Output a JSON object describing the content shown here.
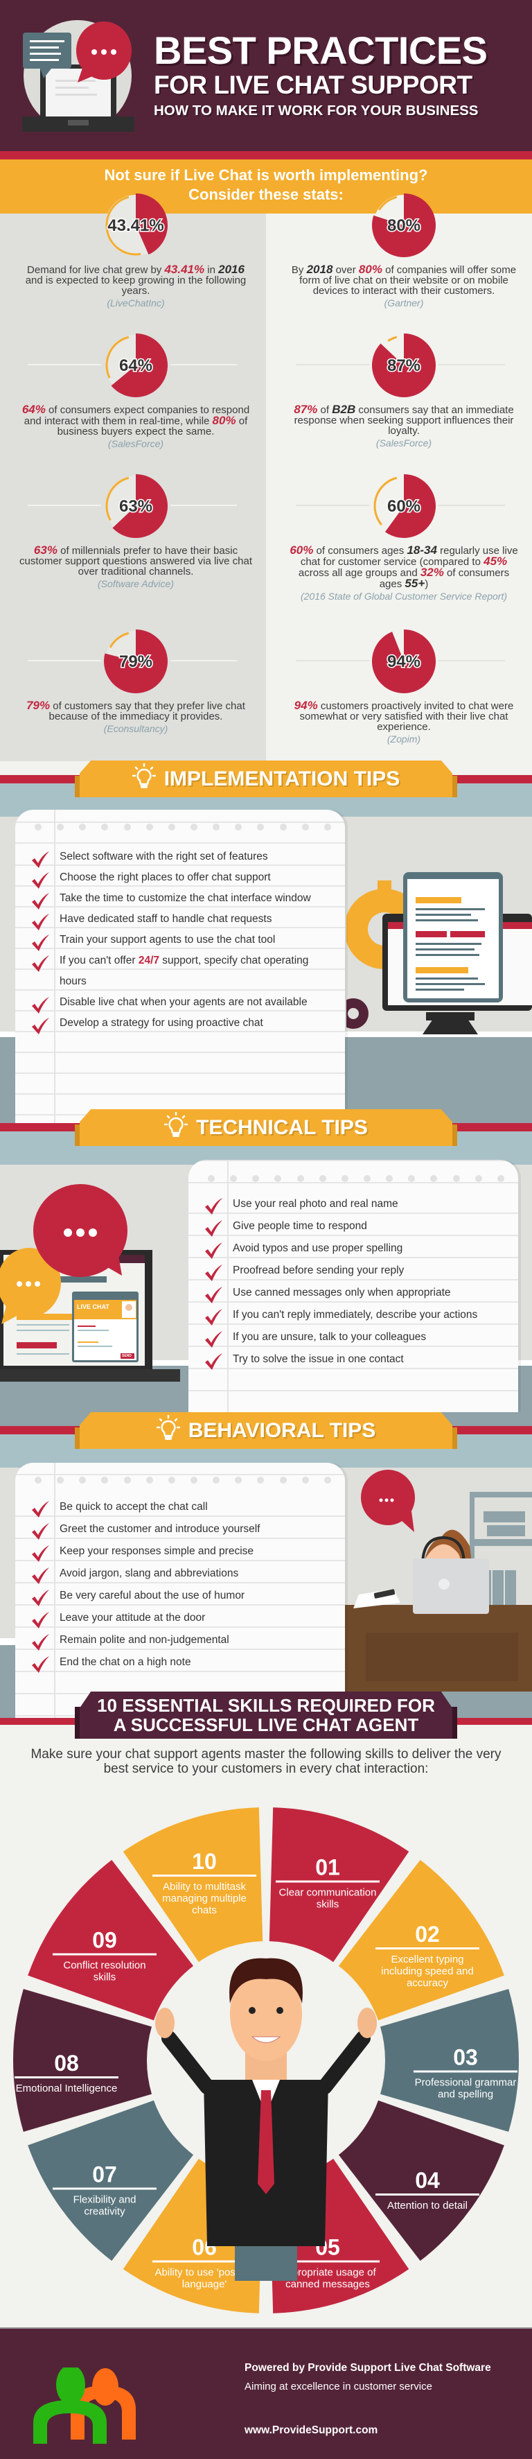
{
  "header": {
    "title_line1": "BEST PRACTICES",
    "title_line2": "FOR LIVE CHAT SUPPORT",
    "subtitle": "HOW TO MAKE IT WORK FOR YOUR BUSINESS"
  },
  "stats_intro": {
    "line1": "Not sure if Live Chat is worth implementing?",
    "line2": "Consider these stats:"
  },
  "colors": {
    "red": "#c2263f",
    "orange": "#f4ad2e",
    "slate": "#58737b",
    "maroon": "#532438",
    "source": "#8aa2ac"
  },
  "stats": {
    "left": [
      {
        "value": 43.41,
        "label": "43.41%",
        "segments": [
          {
            "text": "Demand for live chat grew by "
          },
          {
            "text": "43.41%",
            "style": "red"
          },
          {
            "text": " in "
          },
          {
            "text": "2016",
            "style": "dark"
          },
          {
            "text": " and is expected to keep growing in the following years."
          }
        ],
        "source": "(LiveChatInc)"
      },
      {
        "value": 64,
        "label": "64%",
        "segments": [
          {
            "text": "64%",
            "style": "red"
          },
          {
            "text": " of consumers expect companies to respond and interact with them in real-time, while "
          },
          {
            "text": "80%",
            "style": "red"
          },
          {
            "text": " of business buyers expect the same."
          }
        ],
        "source": "(SalesForce)"
      },
      {
        "value": 63,
        "label": "63%",
        "segments": [
          {
            "text": "63%",
            "style": "red"
          },
          {
            "text": " of millennials prefer to have their basic customer support questions answered via live chat over traditional channels."
          }
        ],
        "source": "(Software Advice)"
      },
      {
        "value": 79,
        "label": "79%",
        "segments": [
          {
            "text": "79%",
            "style": "red"
          },
          {
            "text": " of customers say that they prefer live chat because of the immediacy it provides."
          }
        ],
        "source": "(Econsultancy)"
      }
    ],
    "right": [
      {
        "value": 80,
        "label": "80%",
        "segments": [
          {
            "text": "By "
          },
          {
            "text": "2018",
            "style": "dark"
          },
          {
            "text": " over "
          },
          {
            "text": "80%",
            "style": "red"
          },
          {
            "text": " of companies will offer some form of live chat on their website or on mobile devices to interact with their customers."
          }
        ],
        "source": "(Gartner)"
      },
      {
        "value": 87,
        "label": "87%",
        "segments": [
          {
            "text": "87%",
            "style": "red"
          },
          {
            "text": " of "
          },
          {
            "text": "B2B",
            "style": "dark"
          },
          {
            "text": " consumers say that an immediate response when seeking support influences their loyalty."
          }
        ],
        "source": "(SalesForce)"
      },
      {
        "value": 60,
        "label": "60%",
        "segments": [
          {
            "text": "60%",
            "style": "red"
          },
          {
            "text": " of consumers ages "
          },
          {
            "text": "18-34",
            "style": "dark"
          },
          {
            "text": " regularly use live chat for customer service (compared to "
          },
          {
            "text": "45%",
            "style": "red"
          },
          {
            "text": " across all age groups and "
          },
          {
            "text": "32%",
            "style": "red"
          },
          {
            "text": " of consumers ages "
          },
          {
            "text": "55+",
            "style": "dark"
          },
          {
            "text": ")"
          }
        ],
        "source": "(2016 State of Global Customer Service Report)"
      },
      {
        "value": 94,
        "label": "94%",
        "segments": [
          {
            "text": "94%",
            "style": "red"
          },
          {
            "text": " customers proactively invited to chat were somewhat or very satisfied with their live chat experience."
          }
        ],
        "source": "(Zopim)"
      }
    ]
  },
  "tips": {
    "implementation": {
      "title": "IMPLEMENTATION TIPS",
      "items": [
        "Select software with the right set of features",
        "Choose the right places to offer chat support",
        "Take the time to customize the chat interface window",
        "Have dedicated staff to handle chat requests",
        "Train your support agents to use the chat tool",
        [
          {
            "text": "If you can't offer "
          },
          {
            "text": "24/7",
            "style": "red"
          },
          {
            "text": " support, specify chat operating hours"
          }
        ],
        "Disable live chat when your agents are not available",
        "Develop a strategy for using proactive chat"
      ]
    },
    "technical": {
      "title": "TECHNICAL TIPS",
      "illustration_label": "LIVE CHAT",
      "send_label": "SEND",
      "items": [
        "Use your real photo and real name",
        "Give people time to respond",
        "Avoid typos and use proper spelling",
        "Proofread before sending your reply",
        "Use canned messages only when appropriate",
        "If you can't reply immediately, describe your actions",
        "If you are unsure, talk to your colleagues",
        "Try to solve the issue in one contact"
      ]
    },
    "behavioral": {
      "title": "BEHAVIORAL TIPS",
      "items": [
        "Be quick to accept the chat call",
        "Greet the customer and introduce yourself",
        "Keep your responses simple and precise",
        "Avoid jargon, slang and abbreviations",
        "Be very careful about the use of humor",
        "Leave your attitude at the door",
        "Remain polite and non-judgemental",
        "End the chat on a high note"
      ]
    }
  },
  "skills": {
    "title_line1": "10 ESSENTIAL SKILLS REQUIRED FOR",
    "title_line2": "A SUCCESSFUL LIVE CHAT AGENT",
    "intro": "Make sure your chat support agents master the following skills to deliver the very best service to your customers in every chat interaction:",
    "items": [
      {
        "num": "01",
        "text": "Clear communication skills",
        "color": "#c2263f"
      },
      {
        "num": "02",
        "text": "Excellent typing including speed and accuracy",
        "color": "#f4ad2e"
      },
      {
        "num": "03",
        "text": "Professional grammar and spelling",
        "color": "#58737b"
      },
      {
        "num": "04",
        "text": "Attention to detail",
        "color": "#532438"
      },
      {
        "num": "05",
        "text": "Appropriate usage of canned messages",
        "color": "#c2263f"
      },
      {
        "num": "06",
        "text": "Ability to use 'positive language'",
        "color": "#f4ad2e"
      },
      {
        "num": "07",
        "text": "Flexibility and creativity",
        "color": "#58737b"
      },
      {
        "num": "08",
        "text": "Emotional Intelligence",
        "color": "#532438"
      },
      {
        "num": "09",
        "text": "Conflict resolution skills",
        "color": "#c2263f"
      },
      {
        "num": "10",
        "text": "Ability to multitask managing multiple chats",
        "color": "#f4ad2e"
      }
    ]
  },
  "footer": {
    "powered_by": "Powered by Provide Support Live Chat Software",
    "tagline": "Aiming at excellence in customer service",
    "website": "www.ProvideSupport.com"
  }
}
